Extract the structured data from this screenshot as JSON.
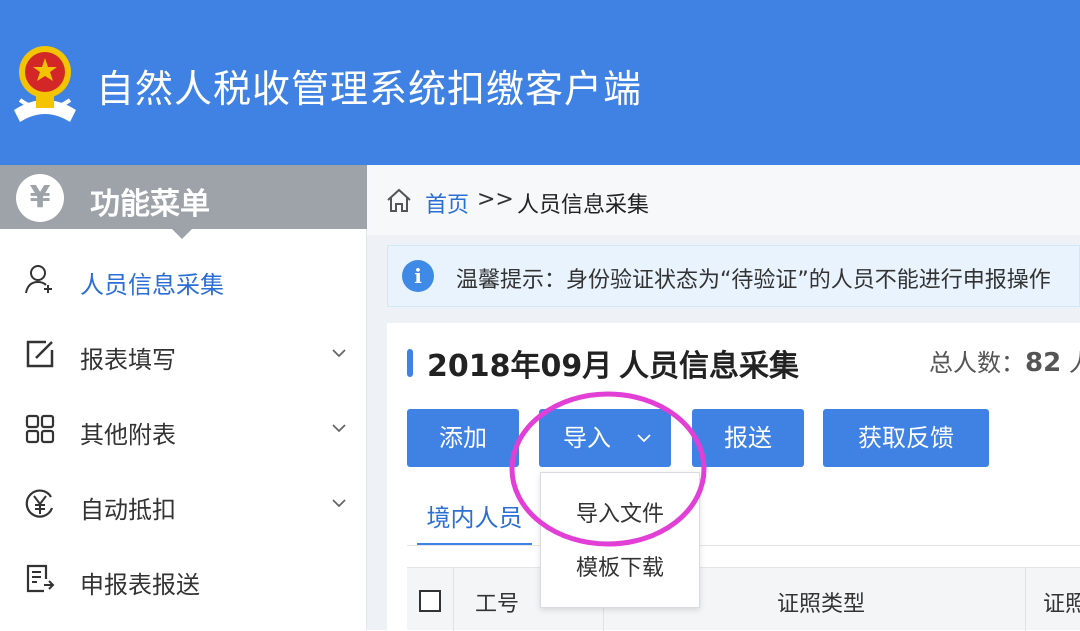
{
  "header": {
    "app_title": "自然人税收管理系统扣缴客户端",
    "emblem_icon": "national-emblem-icon"
  },
  "sidebar": {
    "menu_title": "功能菜单",
    "menu_icon": "yen-icon",
    "items": [
      {
        "label": "人员信息采集",
        "icon": "user-add-icon",
        "active": true,
        "expandable": false
      },
      {
        "label": "报表填写",
        "icon": "edit-icon",
        "active": false,
        "expandable": true
      },
      {
        "label": "其他附表",
        "icon": "grid-icon",
        "active": false,
        "expandable": true
      },
      {
        "label": "自动抵扣",
        "icon": "yen-circle-icon",
        "active": false,
        "expandable": true
      },
      {
        "label": "申报表报送",
        "icon": "document-send-icon",
        "active": false,
        "expandable": false
      }
    ]
  },
  "breadcrumb": {
    "home": "首页",
    "separator": ">>",
    "current": "人员信息采集"
  },
  "notice": {
    "text": "温馨提示：身份验证状态为“待验证”的人员不能进行申报操作"
  },
  "panel": {
    "period": "2018年09月",
    "title": "人员信息采集",
    "total_label": "总人数：",
    "total_value": "82",
    "total_suffix": "人"
  },
  "toolbar": {
    "add_label": "添加",
    "import_label": "导入",
    "send_label": "报送",
    "feedback_label": "获取反馈"
  },
  "import_menu": {
    "items": [
      "导入文件",
      "模板下载"
    ]
  },
  "tabs": {
    "domestic": "境内人员"
  },
  "table": {
    "columns": [
      "工号",
      "证照类型",
      "证照"
    ]
  },
  "colors": {
    "header_bg": "#3f82e4",
    "accent": "#2b6fd6",
    "menu_head_bg": "#9da3a8",
    "highlight": "#e23fd6"
  }
}
